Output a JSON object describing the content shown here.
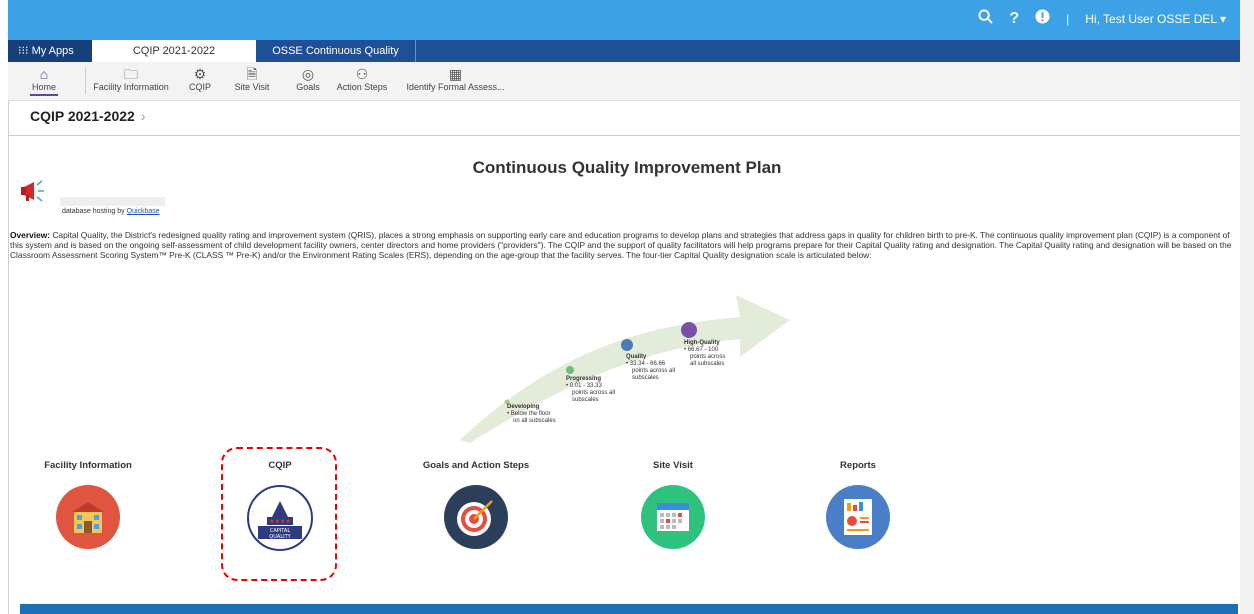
{
  "topbar": {
    "search_icon": "search-icon",
    "help_icon": "help-icon",
    "alert_icon": "alert-icon",
    "user_label": "Hi, Test User OSSE DEL",
    "color": "#3da1e6"
  },
  "tabs": {
    "my_apps": "My Apps",
    "items": [
      "CQIP 2021-2022",
      "OSSE Continuous Quality Impro..."
    ]
  },
  "toolbar": {
    "items": [
      "Home",
      "Facility Information",
      "CQIP",
      "Site Visit",
      "Goals",
      "Action Steps",
      "Identify Formal Assess..."
    ]
  },
  "breadcrumb": {
    "label": "CQIP 2021-2022"
  },
  "page": {
    "title": "Continuous Quality Improvement Plan",
    "hosting_prefix": "database hosting by",
    "hosting_link": "Quickbase",
    "overview_label": "Overview:",
    "overview_text": "Capital Quality, the District's redesigned quality rating and improvement system (QRIS), places a strong emphasis on supporting early care and education programs to develop plans and strategies that address gaps in quality for children birth to pre-K. The continuous quality improvement plan (CQIP) is a component of this system and is based on the ongoing self-assessment of child development facility owners, center directors and home providers (\"providers\"). The CQIP and the support of quality facilitators will help programs prepare for their Capital Quality rating and designation. The Capital Quality rating and designation will be based on the Classroom Assessment Scoring System™ Pre-K (CLASS ™ Pre-K) and/or the Environment Rating Scales (ERS), depending on the age-group that the facility serves. The four-tier Capital Quality designation scale is articulated below:"
  },
  "stages": [
    {
      "name": "Developing",
      "l1": "• Below the floor",
      "l2": "on all subscales",
      "l3": ""
    },
    {
      "name": "Progressing",
      "l1": "• 0.01 - 33.33",
      "l2": "points across all",
      "l3": "subscales"
    },
    {
      "name": "Quality",
      "l1": "• 33.34 - 66.66",
      "l2": "points across all",
      "l3": "subscales"
    },
    {
      "name": "High-Quality",
      "l1": "• 66.67 - 100",
      "l2": "points across",
      "l3": "all subscales"
    }
  ],
  "tiles": [
    "Facility Information",
    "CQIP",
    "Goals and Action Steps",
    "Site Visit",
    "Reports"
  ],
  "cqip_logo_text": {
    "line1": "CAPITAL",
    "line2": "QUALITY"
  }
}
